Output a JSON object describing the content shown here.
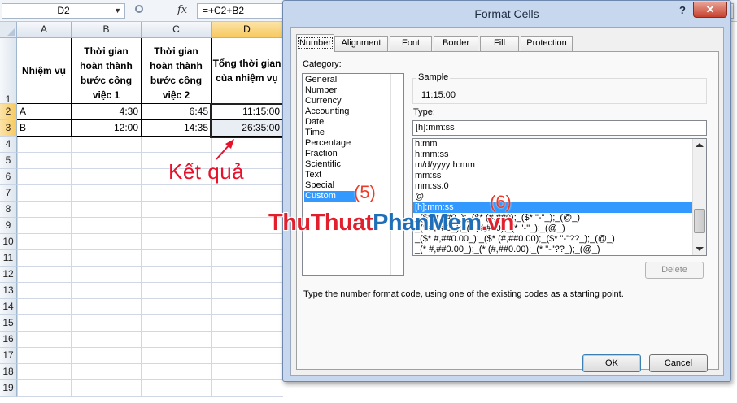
{
  "formula_bar": {
    "name_box": "D2",
    "fx": "fx",
    "formula": "=+C2+B2"
  },
  "sheet": {
    "columns": [
      "A",
      "B",
      "C",
      "D"
    ],
    "rows": [
      "1",
      "2",
      "3",
      "4",
      "5",
      "6",
      "7",
      "8",
      "9",
      "10",
      "11",
      "12",
      "13",
      "14",
      "15",
      "16",
      "17",
      "18",
      "19"
    ],
    "headers": {
      "a": "Nhiệm vụ",
      "b": "Thời gian hoàn thành bước công việc 1",
      "c": "Thời gian hoàn thành bước công việc 2",
      "d": "Tổng thời gian của nhiệm vụ"
    },
    "data": [
      {
        "a": "A",
        "b": "4:30",
        "c": "6:45",
        "d": "11:15:00"
      },
      {
        "a": "B",
        "b": "12:00",
        "c": "14:35",
        "d": "26:35:00"
      }
    ]
  },
  "annotation": {
    "result_label": "Kết quả",
    "step5": "(5)",
    "step6": "(6)"
  },
  "watermark": {
    "part1": "ThuThuat",
    "part2": "PhanMem",
    "part3": ".vn"
  },
  "dialog": {
    "title": "Format Cells",
    "help": "?",
    "close": "✕",
    "tabs": [
      "Number",
      "Alignment",
      "Font",
      "Border",
      "Fill",
      "Protection"
    ],
    "category_label": "Category:",
    "categories": [
      "General",
      "Number",
      "Currency",
      "Accounting",
      "Date",
      "Time",
      "Percentage",
      "Fraction",
      "Scientific",
      "Text",
      "Special",
      "Custom"
    ],
    "selected_category": "Custom",
    "sample_label": "Sample",
    "sample_value": "11:15:00",
    "type_label": "Type:",
    "type_value": "[h]:mm:ss",
    "type_list": [
      "h:mm",
      "h:mm:ss",
      "m/d/yyyy h:mm",
      "mm:ss",
      "mm:ss.0",
      "@",
      "[h]:mm:ss",
      "_($* #,##0_);_($* (#,##0);_($* \"-\"_);_(@_)",
      "_(* #,##0_);_(* (#,##0);_(* \"-\"_);_(@_)",
      "_($* #,##0.00_);_($* (#,##0.00);_($* \"-\"??_);_(@_)",
      "_(* #,##0.00_);_(* (#,##0.00);_(* \"-\"??_);_(@_)"
    ],
    "selected_type": "[h]:mm:ss",
    "delete_label": "Delete",
    "hint": "Type the number format code, using one of the existing codes as a starting point.",
    "ok_label": "OK",
    "cancel_label": "Cancel"
  },
  "colors": {
    "accent_select": "#3399ff",
    "annotation_red": "#e8102a",
    "watermark_blue": "#1f6fb8"
  }
}
